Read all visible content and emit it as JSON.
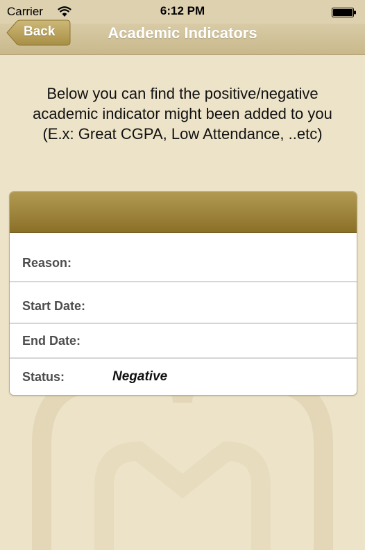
{
  "status_bar": {
    "carrier": "Carrier",
    "time": "6:12 PM"
  },
  "nav": {
    "back_label": "Back",
    "title": "Academic Indicators"
  },
  "intro": {
    "text": "Below you can find the positive/negative academic indicator might been added to you (E.x: Great CGPA, Low Attendance, ..etc)"
  },
  "indicator": {
    "reason_label": "Reason:",
    "reason_value": "",
    "start_date_label": "Start Date:",
    "start_date_value": "",
    "end_date_label": "End Date:",
    "end_date_value": "",
    "status_label": "Status:",
    "status_value": "Negative"
  },
  "colors": {
    "background": "#ede3c8",
    "nav_bar": "#d1c29b",
    "card_header": "#9e8539"
  },
  "icons": [
    "wifi-icon",
    "battery-icon",
    "back-chevron-icon"
  ]
}
